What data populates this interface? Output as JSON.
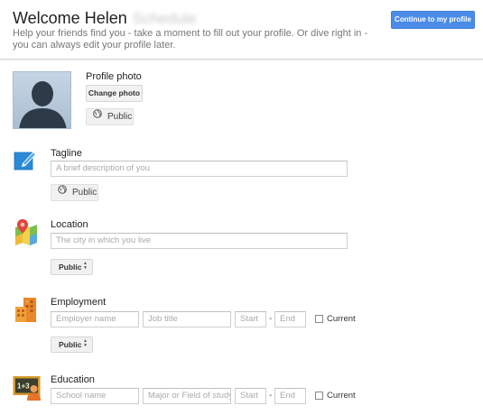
{
  "header": {
    "title": "Welcome Helen",
    "name_blurred": "Schedule",
    "subtitle": "Help your friends find you - take a moment to fill out your profile. Or dive right in - you can always edit your profile later.",
    "continue_label": "Continue to my profile"
  },
  "colors": {
    "accent": "#4a8ce8",
    "text": "#222222",
    "muted": "#777777"
  },
  "photo": {
    "label": "Profile photo",
    "change_label": "Change photo",
    "visibility": "Public"
  },
  "tagline": {
    "label": "Tagline",
    "placeholder": "A brief description of you",
    "visibility": "Public",
    "icon": "tagline-pencil-icon"
  },
  "location": {
    "label": "Location",
    "placeholder": "The city in which you live",
    "visibility": "Public",
    "icon": "map-pin-icon"
  },
  "employment": {
    "label": "Employment",
    "employer_placeholder": "Employer name",
    "title_placeholder": "Job title",
    "start_placeholder": "Start",
    "end_placeholder": "End",
    "separator": "-",
    "current_label": "Current",
    "visibility": "Public",
    "icon": "building-icon"
  },
  "education": {
    "label": "Education",
    "school_placeholder": "School name",
    "major_placeholder": "Major or Field of study",
    "start_placeholder": "Start",
    "end_placeholder": "End",
    "separator": "-",
    "current_label": "Current",
    "icon": "chalkboard-icon"
  }
}
